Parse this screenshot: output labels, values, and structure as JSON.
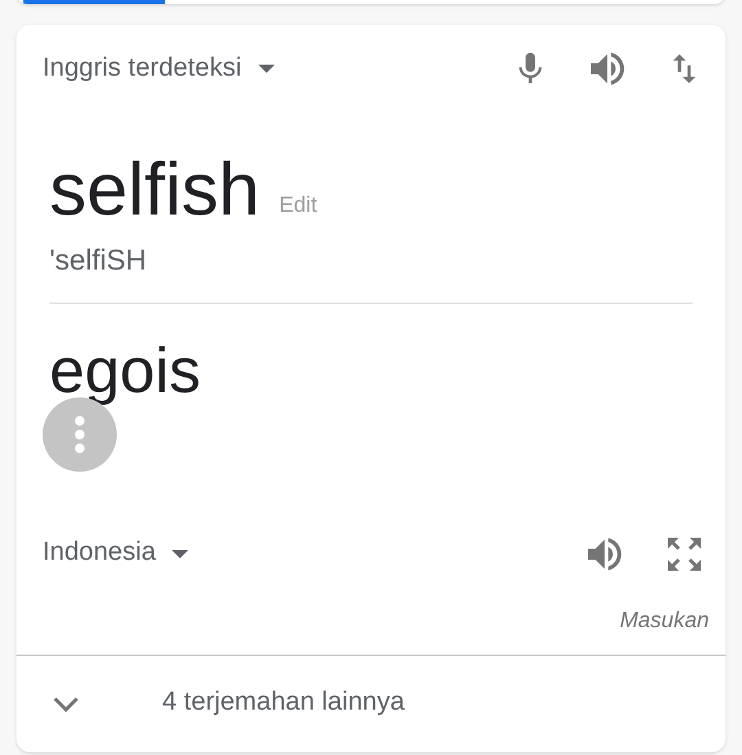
{
  "source": {
    "language": "Inggris terdeteksi",
    "text": "selfish",
    "edit_link": "Edit",
    "phonetic": "'selfiSH"
  },
  "target": {
    "text": "egois",
    "language": "Indonesia",
    "feedback": "Masukan"
  },
  "more_translations": {
    "label": "4 terjemahan lainnya",
    "expanded": false
  }
}
